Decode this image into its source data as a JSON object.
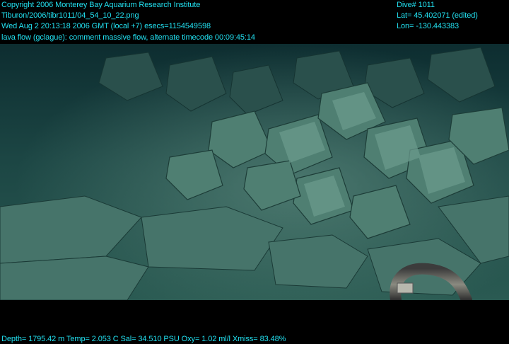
{
  "header": {
    "copyright": "Copyright 2006 Monterey Bay Aquarium Research Institute",
    "file_path": "Tiburon/2006/tibr1011/04_54_10_22.png",
    "timestamp": "Wed Aug  2 20:13:18 2006 GMT (local +7)  esecs=1154549598",
    "annotation": "lava flow (gclague): comment massive flow, alternate timecode 00:09:45:14"
  },
  "dive_info": {
    "dive": "Dive# 1011",
    "lat": "Lat= 45.402071 (edited)",
    "lon": "Lon= -130.443383"
  },
  "footer": {
    "sensors": "Depth= 1795.42 m  Temp= 2.053 C  Sal= 34.510 PSU  Oxy= 1.02 ml/l  Xmiss= 83.48%"
  },
  "colors": {
    "overlay_text": "#22e0f0",
    "water_dark": "#0c2a2c",
    "rock_light": "#6a9a8e"
  }
}
